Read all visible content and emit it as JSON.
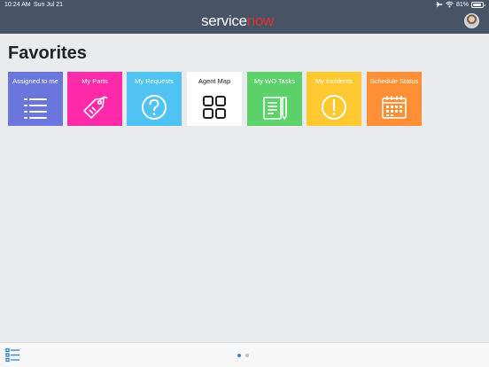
{
  "status_bar": {
    "time": "10:24 AM",
    "date": "Sun Jul 21",
    "battery": "81%"
  },
  "header": {
    "logo_part1": "service",
    "logo_part2": "now"
  },
  "page": {
    "title": "Favorites"
  },
  "tiles": [
    {
      "label": "Assigned to me",
      "color": "#6b76dc",
      "icon": "list-icon"
    },
    {
      "label": "My Parts",
      "color": "#ff2aa9",
      "icon": "tag-icon"
    },
    {
      "label": "My Requests",
      "color": "#4fc4f4",
      "icon": "question-icon"
    },
    {
      "label": "Agent Map",
      "color": "#ffffff",
      "icon": "grid-icon"
    },
    {
      "label": "My WO Tasks",
      "color": "#5dd26a",
      "icon": "document-icon"
    },
    {
      "label": "My Incidents",
      "color": "#fec831",
      "icon": "alert-icon"
    },
    {
      "label": "Schedule Status",
      "color": "#ff8f34",
      "icon": "calendar-icon"
    }
  ],
  "pager": {
    "pages": 2,
    "current": 1
  }
}
